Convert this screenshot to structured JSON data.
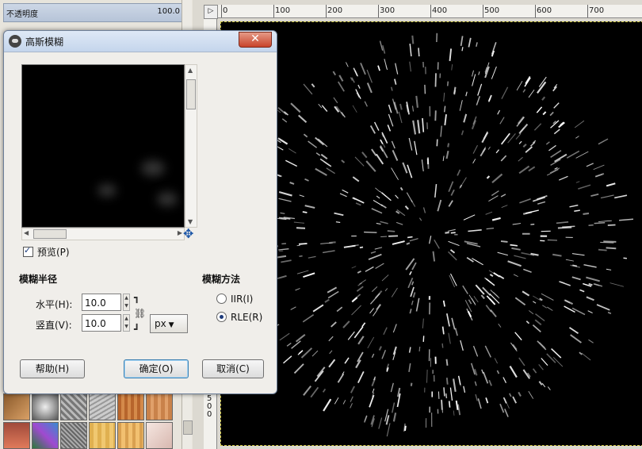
{
  "dock": {
    "opacity_label": "不透明度",
    "opacity_value": "100.0"
  },
  "ruler": {
    "marks": [
      "0",
      "100",
      "200",
      "300",
      "400",
      "500",
      "600",
      "700"
    ],
    "vertical_marks": [
      "5",
      "0",
      "0"
    ]
  },
  "dialog": {
    "title": "高斯模糊",
    "close_label": "✕",
    "preview_label": "预览(P)",
    "preview_checked": true,
    "radius_heading": "模糊半径",
    "horizontal_label": "水平(H):",
    "horizontal_value": "10.0",
    "vertical_label": "竖直(V):",
    "vertical_value": "10.0",
    "unit": "px",
    "method_heading": "模糊方法",
    "methods": [
      {
        "label": "IIR(I)",
        "selected": false
      },
      {
        "label": "RLE(R)",
        "selected": true
      }
    ],
    "help_button": "帮助(H)",
    "ok_button": "确定(O)",
    "cancel_button": "取消(C)"
  },
  "colors": {
    "accent": "#3c7fb1",
    "close": "#c9442b",
    "canvas": "#000000"
  }
}
